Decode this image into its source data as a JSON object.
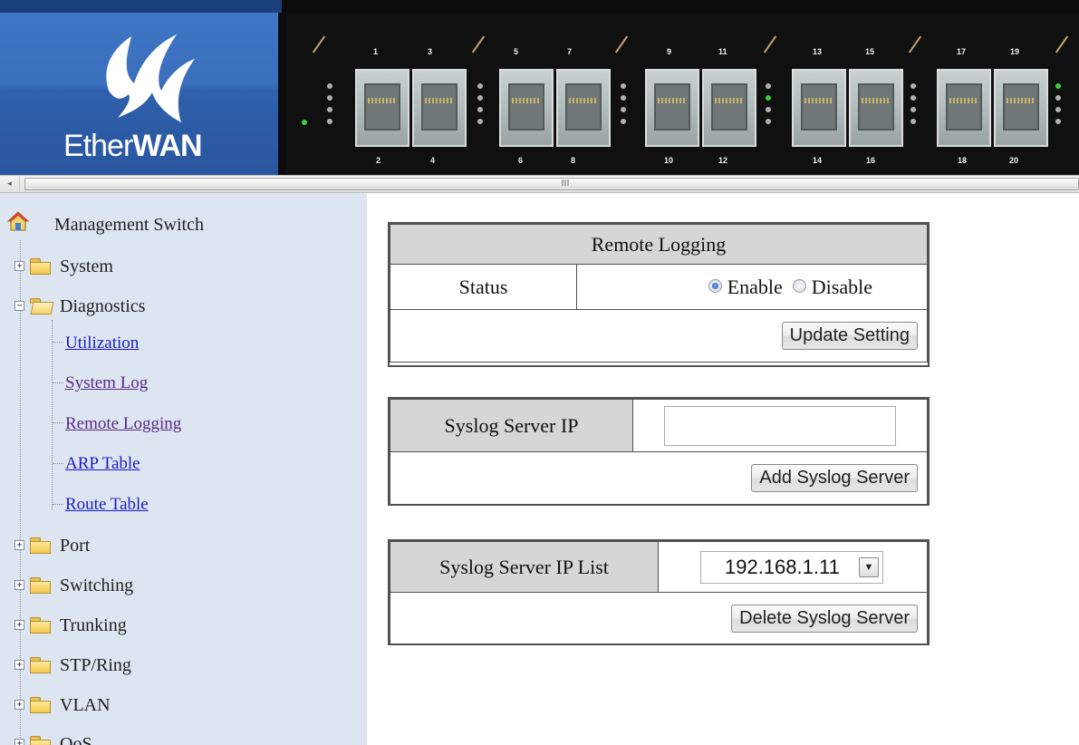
{
  "header": {
    "brand_light": "Ether",
    "brand_bold": "WAN",
    "port_numbers_top": [
      "1",
      "3",
      "5",
      "7",
      "9",
      "11",
      "13",
      "15",
      "17",
      "19"
    ],
    "port_numbers_bottom": [
      "2",
      "4",
      "6",
      "8",
      "10",
      "12",
      "14",
      "16",
      "18",
      "20"
    ]
  },
  "scrollbar": {
    "left_arrow": "◂",
    "grip": "III"
  },
  "sidebar": {
    "root": "Management Switch",
    "items": [
      {
        "label": "System",
        "expanded": false,
        "toggle": "+"
      },
      {
        "label": "Diagnostics",
        "expanded": true,
        "toggle": "−",
        "children": [
          "Utilization",
          "System Log",
          "Remote Logging",
          "ARP Table",
          "Route Table"
        ]
      },
      {
        "label": "Port",
        "expanded": false,
        "toggle": "+"
      },
      {
        "label": "Switching",
        "expanded": false,
        "toggle": "+"
      },
      {
        "label": "Trunking",
        "expanded": false,
        "toggle": "+"
      },
      {
        "label": "STP/Ring",
        "expanded": false,
        "toggle": "+"
      },
      {
        "label": "VLAN",
        "expanded": false,
        "toggle": "+"
      },
      {
        "label": "QoS",
        "expanded": false,
        "toggle": "+"
      }
    ]
  },
  "remote_logging": {
    "title": "Remote Logging",
    "status_label": "Status",
    "enable_label": "Enable",
    "disable_label": "Disable",
    "selected": "Enable",
    "update_button": "Update Setting"
  },
  "syslog_server": {
    "label": "Syslog Server IP",
    "value": "",
    "add_button": "Add Syslog Server"
  },
  "syslog_list": {
    "label": "Syslog Server IP List",
    "selected": "192.168.1.11",
    "delete_button": "Delete Syslog Server"
  },
  "colors": {
    "logo_blue": "#3a6fbd",
    "sidebar_bg": "#dde6f0",
    "header_cell_bg": "#d6d6d6",
    "link": "#1b1bcc",
    "led_green": "#3bd13b"
  }
}
